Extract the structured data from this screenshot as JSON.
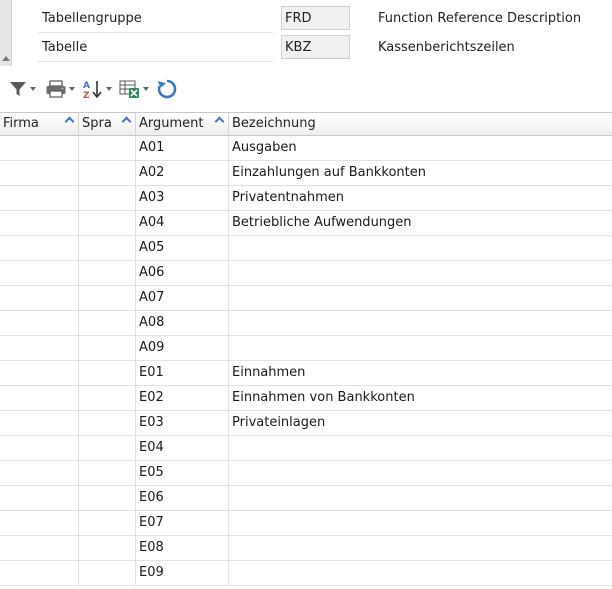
{
  "header": {
    "fields": [
      {
        "label": "Tabellengruppe",
        "value": "FRD",
        "description": "Function Reference Description"
      },
      {
        "label": "Tabelle",
        "value": "KBZ",
        "description": "Kassenberichtszeilen"
      }
    ]
  },
  "toolbar": {
    "icons": [
      "filter-icon",
      "print-icon",
      "sort-az-icon",
      "excel-export-icon",
      "refresh-icon"
    ]
  },
  "grid": {
    "columns": [
      "Firma",
      "Spra",
      "Argument",
      "Bezeichnung"
    ],
    "rows": [
      {
        "firma": "",
        "spra": "",
        "argument": "A01",
        "bezeichnung": "Ausgaben"
      },
      {
        "firma": "",
        "spra": "",
        "argument": "A02",
        "bezeichnung": "Einzahlungen auf Bankkonten"
      },
      {
        "firma": "",
        "spra": "",
        "argument": "A03",
        "bezeichnung": "Privatentnahmen"
      },
      {
        "firma": "",
        "spra": "",
        "argument": "A04",
        "bezeichnung": "Betriebliche Aufwendungen"
      },
      {
        "firma": "",
        "spra": "",
        "argument": "A05",
        "bezeichnung": ""
      },
      {
        "firma": "",
        "spra": "",
        "argument": "A06",
        "bezeichnung": ""
      },
      {
        "firma": "",
        "spra": "",
        "argument": "A07",
        "bezeichnung": ""
      },
      {
        "firma": "",
        "spra": "",
        "argument": "A08",
        "bezeichnung": ""
      },
      {
        "firma": "",
        "spra": "",
        "argument": "A09",
        "bezeichnung": ""
      },
      {
        "firma": "",
        "spra": "",
        "argument": "E01",
        "bezeichnung": "Einnahmen"
      },
      {
        "firma": "",
        "spra": "",
        "argument": "E02",
        "bezeichnung": "Einnahmen von Bankkonten"
      },
      {
        "firma": "",
        "spra": "",
        "argument": "E03",
        "bezeichnung": "Privateinlagen"
      },
      {
        "firma": "",
        "spra": "",
        "argument": "E04",
        "bezeichnung": ""
      },
      {
        "firma": "",
        "spra": "",
        "argument": "E05",
        "bezeichnung": ""
      },
      {
        "firma": "",
        "spra": "",
        "argument": "E06",
        "bezeichnung": ""
      },
      {
        "firma": "",
        "spra": "",
        "argument": "E07",
        "bezeichnung": ""
      },
      {
        "firma": "",
        "spra": "",
        "argument": "E08",
        "bezeichnung": ""
      },
      {
        "firma": "",
        "spra": "",
        "argument": "E09",
        "bezeichnung": ""
      }
    ]
  }
}
